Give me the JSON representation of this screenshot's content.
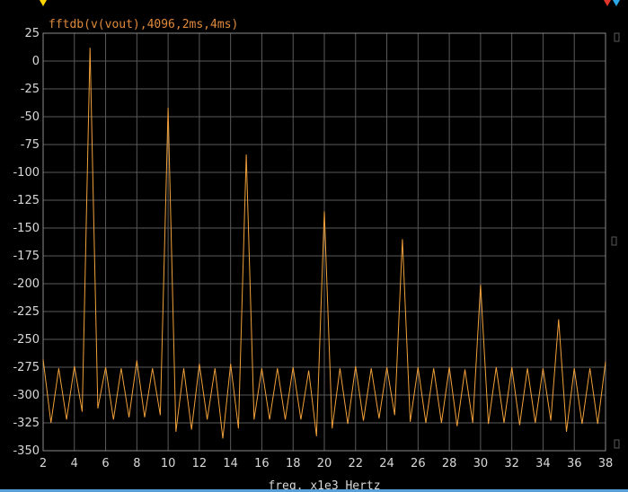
{
  "chart_data": {
    "type": "line",
    "title": "fftdb(v(vout),4096,2ms,4ms)",
    "xlabel": "freq, x1e3 Hertz",
    "ylabel": "",
    "xlim": [
      2,
      38
    ],
    "ylim": [
      -350,
      25
    ],
    "x_ticks": [
      "2",
      "4",
      "6",
      "8",
      "10",
      "12",
      "14",
      "16",
      "18",
      "20",
      "22",
      "24",
      "26",
      "28",
      "30",
      "32",
      "34",
      "36",
      "38"
    ],
    "y_ticks": [
      "25",
      "0",
      "-25",
      "-50",
      "-75",
      "-100",
      "-125",
      "-150",
      "-175",
      "-200",
      "-225",
      "-250",
      "-275",
      "-300",
      "-325",
      "-350"
    ],
    "grid": true,
    "series": [
      {
        "color": "#f0a03a",
        "x": [
          2,
          2.5,
          3,
          3.5,
          4,
          4.5,
          5,
          5.5,
          6,
          6.5,
          7,
          7.5,
          8,
          8.5,
          9,
          9.5,
          10,
          10.5,
          11,
          11.5,
          12,
          12.5,
          13,
          13.5,
          14,
          14.5,
          15,
          15.5,
          16,
          16.5,
          17,
          17.5,
          18,
          18.5,
          19,
          19.5,
          20,
          20.5,
          21,
          21.5,
          22,
          22.5,
          23,
          23.5,
          24,
          24.5,
          25,
          25.5,
          26,
          26.5,
          27,
          27.5,
          28,
          28.5,
          29,
          29.5,
          30,
          30.5,
          31,
          31.5,
          32,
          32.5,
          33,
          33.5,
          34,
          34.5,
          35,
          35.5,
          36,
          36.5,
          37,
          37.5,
          38
        ],
        "values": [
          -268,
          -325,
          -276,
          -322,
          -274,
          -315,
          12,
          -312,
          -275,
          -322,
          -276,
          -320,
          -269,
          -320,
          -276,
          -318,
          -42,
          -333,
          -276,
          -331,
          -272,
          -322,
          -276,
          -339,
          -272,
          -330,
          -84,
          -322,
          -276,
          -322,
          -276,
          -322,
          -275,
          -322,
          -278,
          -337,
          -135,
          -330,
          -276,
          -326,
          -274,
          -323,
          -276,
          -321,
          -275,
          -318,
          -160,
          -324,
          -275,
          -325,
          -276,
          -325,
          -275,
          -328,
          -277,
          -325,
          -201,
          -326,
          -275,
          -325,
          -275,
          -327,
          -276,
          -325,
          -276,
          -323,
          -232,
          -333,
          -276,
          -326,
          -276,
          -326,
          -270
        ]
      }
    ],
    "colors": {
      "background": "#000000",
      "grid": "#5a5a5a",
      "trace": "#f0a03a",
      "title": "#e08a3c",
      "cursor_yellow": "#ffd400",
      "cursor_red": "#e0352b",
      "cursor_blue": "#2aa8e8",
      "bottom_bar": "#5aa0d8"
    }
  }
}
